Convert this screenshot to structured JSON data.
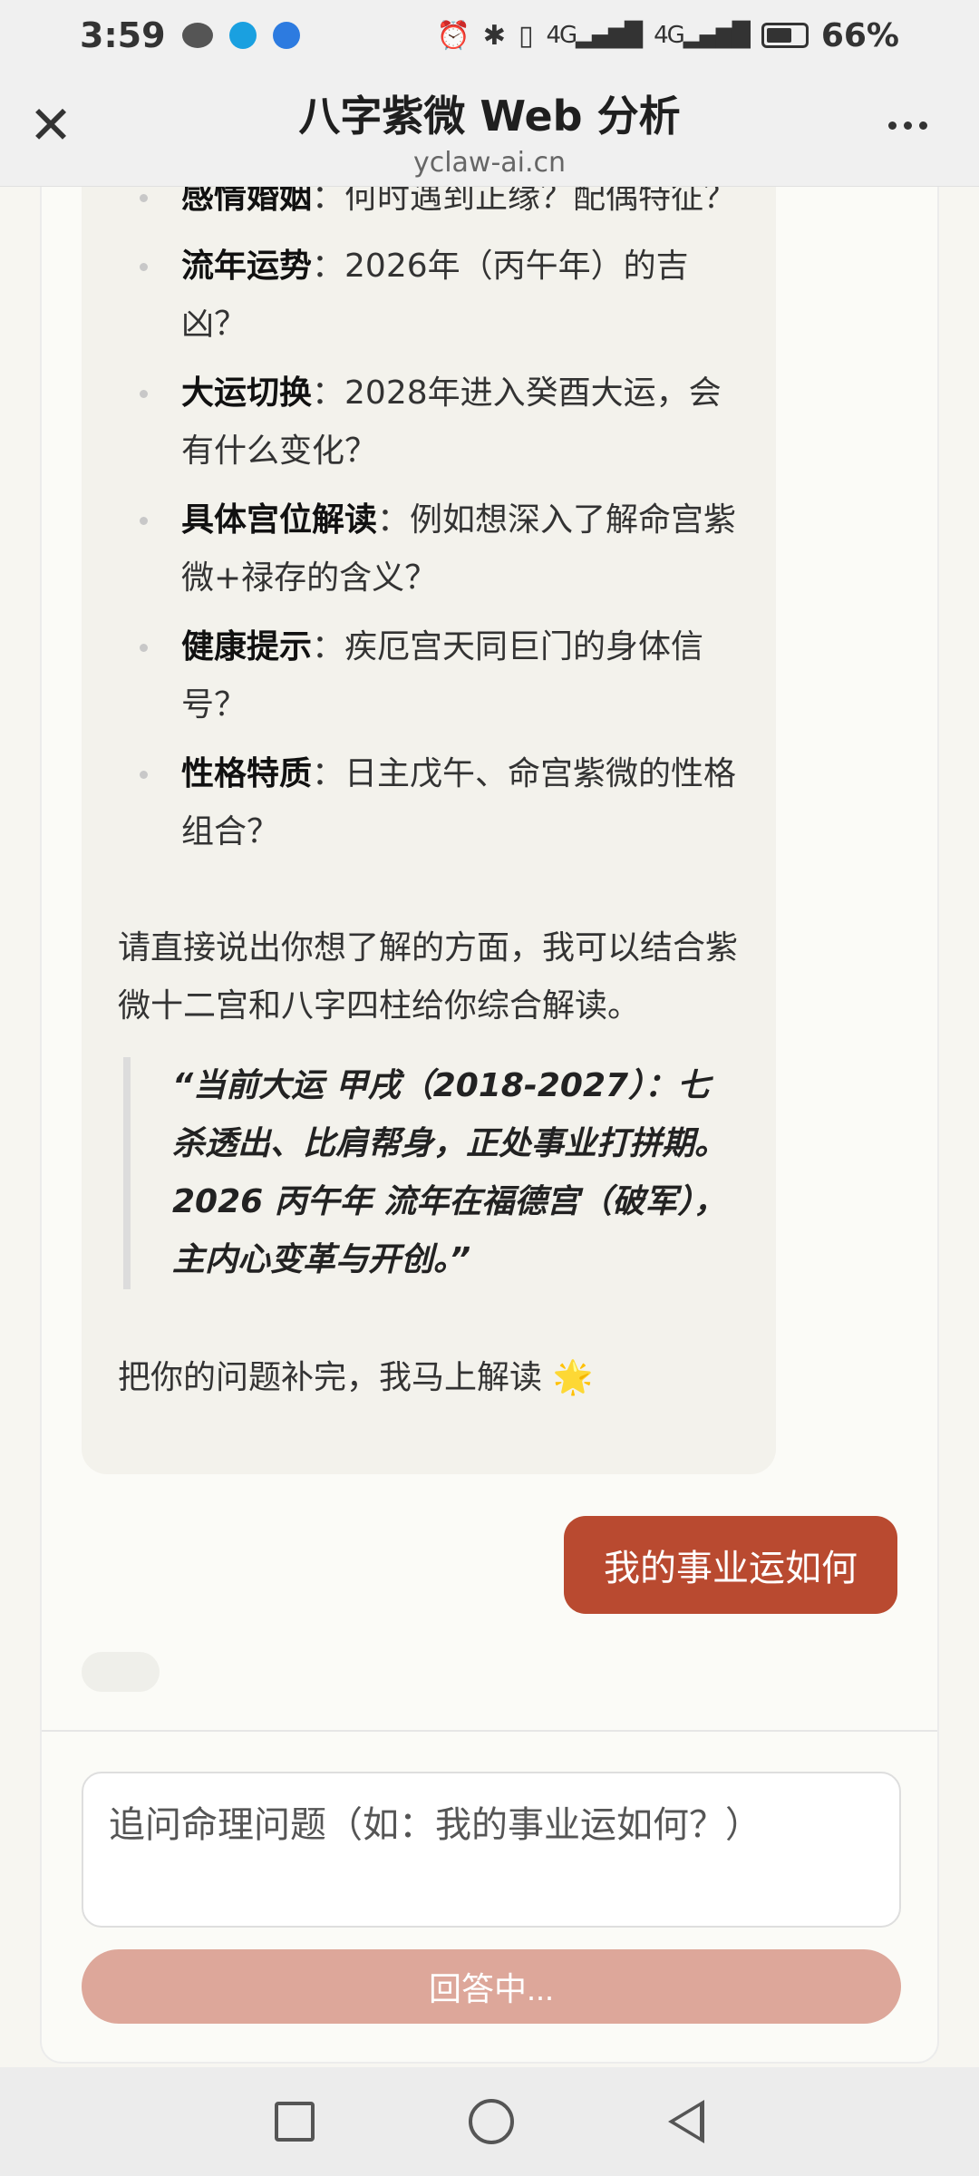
{
  "status_bar": {
    "time": "3:59",
    "network_a": "4G",
    "network_b": "4G",
    "battery": "66%"
  },
  "header": {
    "title": "八字紫微 Web 分析",
    "subtitle": "yclaw-ai.cn"
  },
  "ai_message": {
    "items": [
      {
        "term": "感情婚姻",
        "text": "：何时遇到正缘？配偶特征？"
      },
      {
        "term": "流年运势",
        "text": "：2026年（丙午年）的吉凶？"
      },
      {
        "term": "大运切换",
        "text": "：2028年进入癸酉大运，会有什么变化？"
      },
      {
        "term": "具体宫位解读",
        "text": "：例如想深入了解命宫紫微+禄存的含义？"
      },
      {
        "term": "健康提示",
        "text": "：疾厄宫天同巨门的身体信号？"
      },
      {
        "term": "性格特质",
        "text": "：日主戊午、命宫紫微的性格组合？"
      }
    ],
    "paragraph": "请直接说出你想了解的方面，我可以结合紫微十二宫和八字四柱给你综合解读。",
    "quote": "“当前大运 甲戌（2018-2027）：七杀透出、比肩帮身，正处事业打拼期。2026 丙午年 流年在福德宫（破军），主内心变革与开创。”",
    "closing": "把你的问题补完，我马上解读 🌟"
  },
  "user_message": "我的事业运如何",
  "input": {
    "placeholder": "追问命理问题（如：我的事业运如何？）"
  },
  "submit_label": "回答中...",
  "colors": {
    "user_bubble": "#b94a30",
    "submit_disabled": "#dda79a"
  }
}
